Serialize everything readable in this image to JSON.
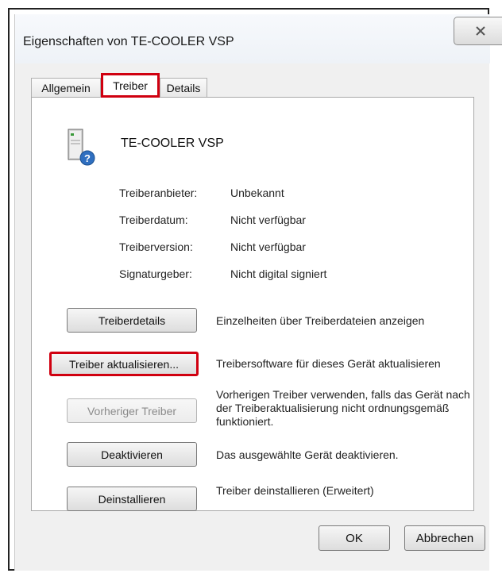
{
  "window": {
    "title": "Eigenschaften von TE-COOLER VSP",
    "close_icon": "close-icon"
  },
  "tabs": [
    {
      "label": "Allgemein",
      "active": false
    },
    {
      "label": "Treiber",
      "active": true
    },
    {
      "label": "Details",
      "active": false
    }
  ],
  "device": {
    "name": "TE-COOLER VSP",
    "icon": "device-unknown-icon"
  },
  "properties": [
    {
      "label": "Treiberanbieter:",
      "value": "Unbekannt"
    },
    {
      "label": "Treiberdatum:",
      "value": "Nicht verfügbar"
    },
    {
      "label": "Treiberversion:",
      "value": "Nicht verfügbar"
    },
    {
      "label": "Signaturgeber:",
      "value": "Nicht digital signiert"
    }
  ],
  "actions": [
    {
      "button": "Treiberdetails",
      "description": "Einzelheiten über Treiberdateien anzeigen",
      "enabled": true
    },
    {
      "button": "Treiber aktualisieren...",
      "description": "Treibersoftware für dieses Gerät aktualisieren",
      "enabled": true
    },
    {
      "button": "Vorheriger Treiber",
      "description": "Vorherigen Treiber verwenden, falls das Gerät nach der Treiberaktualisierung nicht ordnungsgemäß funktioniert.",
      "enabled": false
    },
    {
      "button": "Deaktivieren",
      "description": "Das ausgewählte Gerät deaktivieren.",
      "enabled": true
    },
    {
      "button": "Deinstallieren",
      "description": "Treiber deinstallieren (Erweitert)",
      "enabled": true
    }
  ],
  "footer": {
    "ok_label": "OK",
    "cancel_label": "Abbrechen"
  },
  "colors": {
    "highlight": "#d00010"
  }
}
